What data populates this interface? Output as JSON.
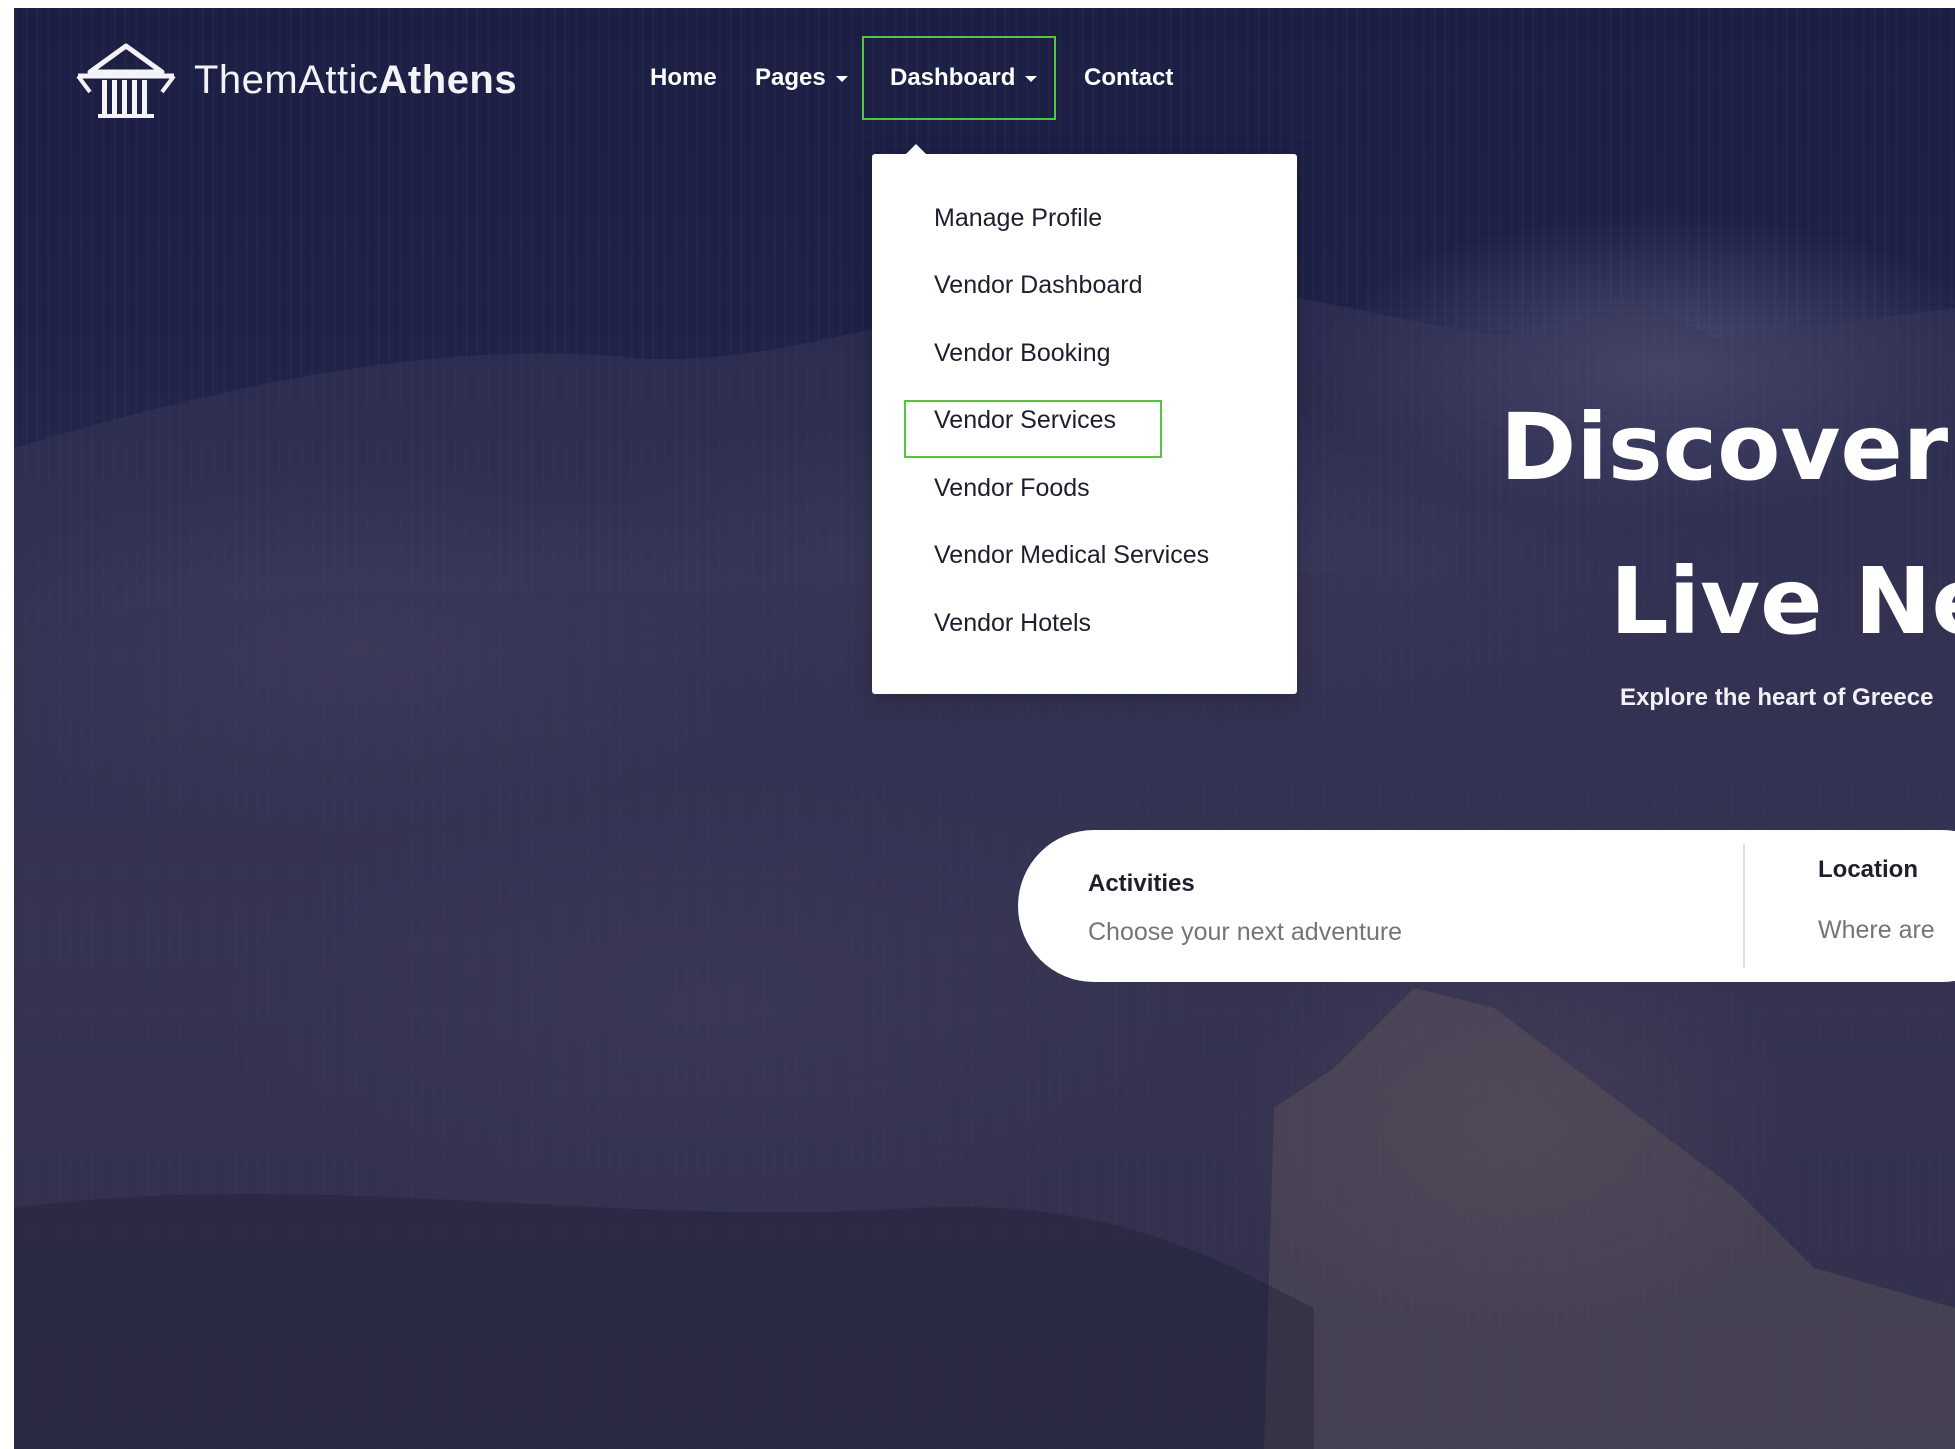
{
  "brand": {
    "name_light": "ThemAttic",
    "name_bold": "Athens",
    "logo_icon": "temple-columns-icon"
  },
  "nav": {
    "home": "Home",
    "pages": "Pages",
    "dashboard": "Dashboard",
    "contact": "Contact"
  },
  "dashboard_menu": {
    "items": [
      "Manage Profile",
      "Vendor Dashboard",
      "Vendor Booking",
      "Vendor Services",
      "Vendor Foods",
      "Vendor Medical Services",
      "Vendor Hotels"
    ],
    "highlighted": "Vendor Services"
  },
  "hero": {
    "title_line1": "Discover",
    "title_line2": "Live Ne",
    "subtitle": "Explore the heart of Greece"
  },
  "search": {
    "activities_label": "Activities",
    "activities_placeholder": "Choose your next adventure",
    "location_label": "Location",
    "location_placeholder": "Where are"
  },
  "colors": {
    "highlight": "#55c443",
    "overlay": "#1f2248"
  }
}
